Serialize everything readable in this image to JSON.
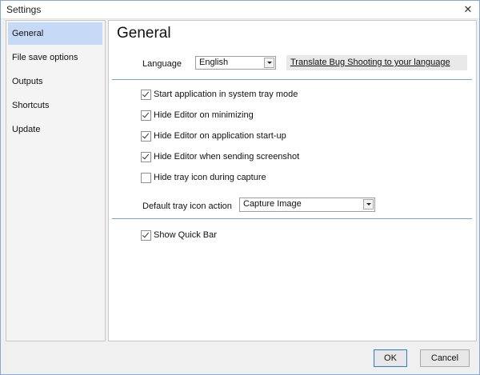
{
  "window": {
    "title": "Settings"
  },
  "sidebar": {
    "items": [
      {
        "label": "General",
        "active": true
      },
      {
        "label": "File save options"
      },
      {
        "label": "Outputs"
      },
      {
        "label": "Shortcuts"
      },
      {
        "label": "Update"
      }
    ]
  },
  "general": {
    "title": "General",
    "language_label": "Language",
    "language_value": "English",
    "translate_link": "Translate Bug Shooting to your language",
    "checkboxes": [
      {
        "label": "Start application in system tray mode",
        "checked": true
      },
      {
        "label": "Hide Editor on minimizing",
        "checked": true
      },
      {
        "label": "Hide Editor on application start-up",
        "checked": true
      },
      {
        "label": "Hide Editor when sending screenshot",
        "checked": true
      },
      {
        "label": "Hide tray icon during capture",
        "checked": false
      }
    ],
    "tray_action_label": "Default tray icon action",
    "tray_action_value": "Capture Image",
    "quickbar": {
      "label": "Show Quick Bar",
      "checked": true
    }
  },
  "footer": {
    "ok_label": "OK",
    "cancel_label": "Cancel"
  },
  "colors": {
    "accent_selection": "#c6d9f7",
    "divider": "#7da2ce",
    "window_border": "#8aa9cf"
  }
}
